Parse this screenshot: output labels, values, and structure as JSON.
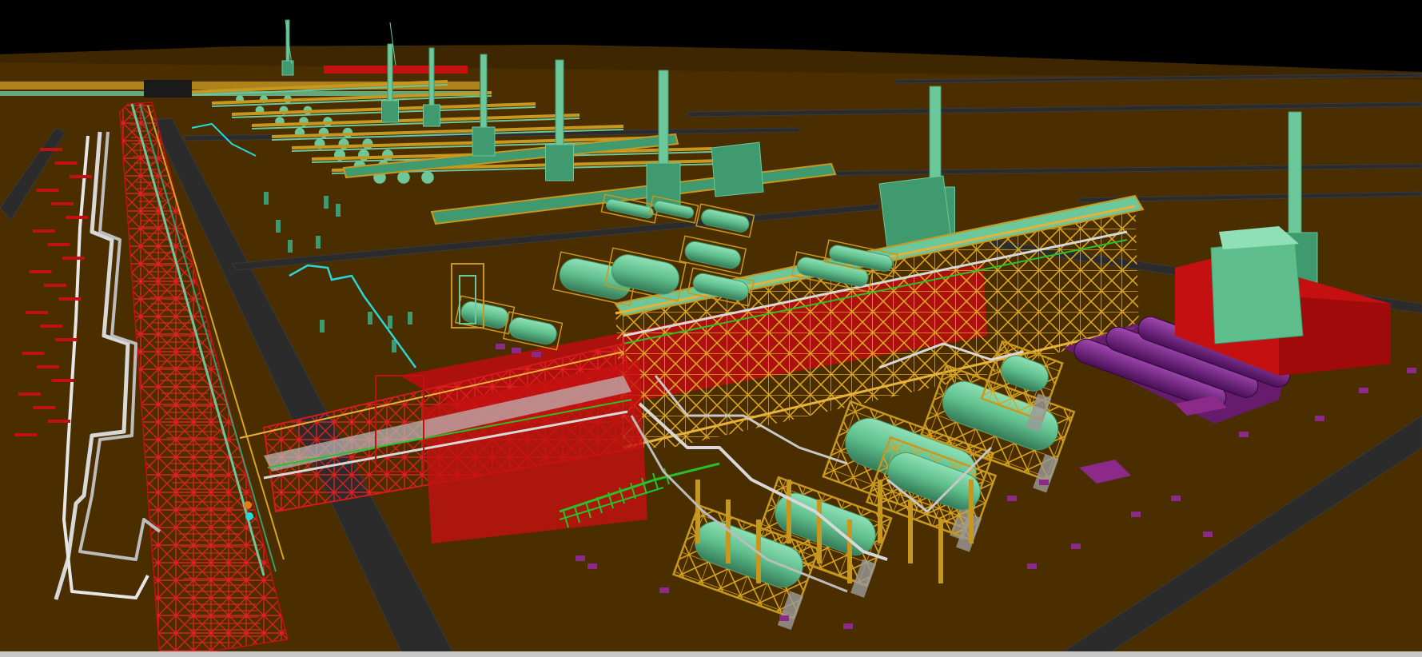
{
  "viewport": {
    "background": "#000000",
    "ground_color": "#4a2e00",
    "road_color": "#2b2b2b",
    "road_edge_color": "#3a3a3a"
  },
  "legend_colors": {
    "steel_structure": "#c7981f",
    "fireproofing_red": "#c41010",
    "equipment_green": "#6cc79a",
    "equipment_green_dark": "#3f9a6f",
    "pipe_white": "#cfcfcf",
    "pipe_green": "#27c227",
    "pipe_cyan": "#28d7d7",
    "vessel_purple": "#7a1f8a",
    "foundation_magenta": "#8c2a8a",
    "foundation_grey": "#9a9a9a"
  },
  "icons": {
    "stack": "chimney-stack-icon",
    "vessel": "horizontal-vessel-icon",
    "pipe_rack": "pipe-rack-icon"
  },
  "status_strip": {
    "color": "#c8c8c8"
  }
}
